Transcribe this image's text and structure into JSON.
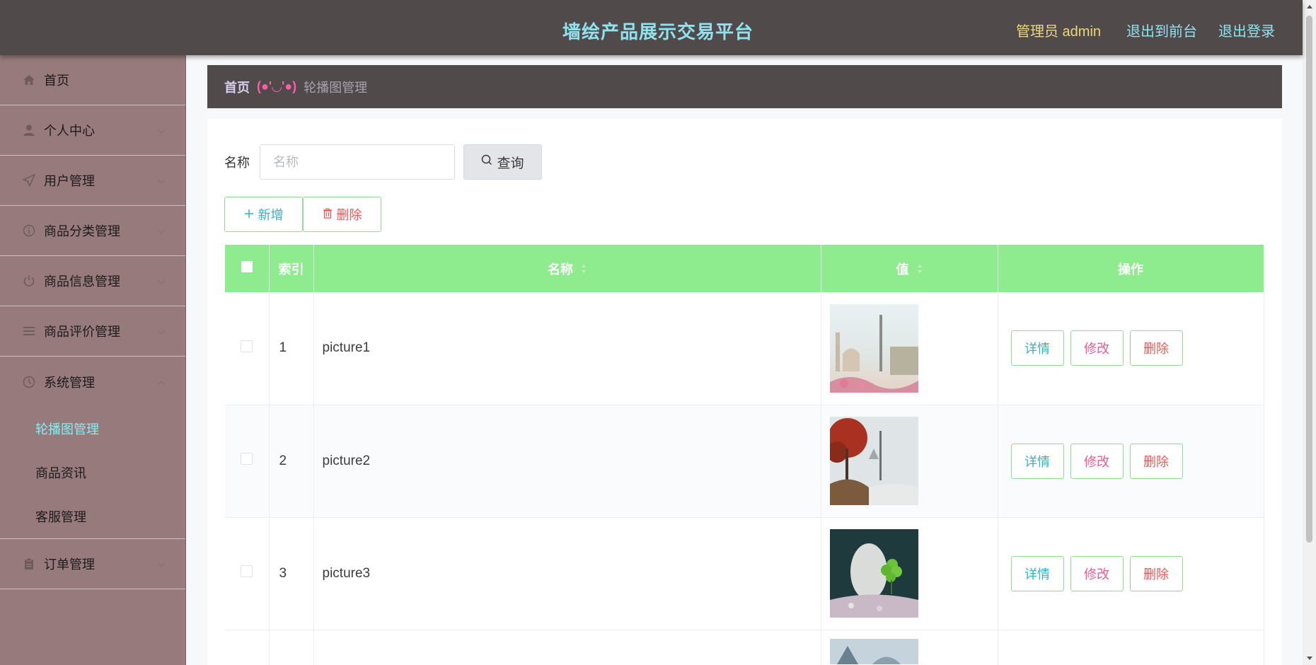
{
  "header": {
    "title": "墙绘产品展示交易平台",
    "admin_label": "管理员 admin",
    "front_link": "退出到前台",
    "logout_link": "退出登录"
  },
  "sidebar": {
    "items": [
      {
        "label": "首页",
        "icon": "home-icon"
      },
      {
        "label": "个人中心",
        "icon": "user-icon"
      },
      {
        "label": "用户管理",
        "icon": "send-icon"
      },
      {
        "label": "商品分类管理",
        "icon": "info-circle-icon"
      },
      {
        "label": "商品信息管理",
        "icon": "power-icon"
      },
      {
        "label": "商品评价管理",
        "icon": "list-icon"
      },
      {
        "label": "系统管理",
        "icon": "clock-icon"
      },
      {
        "label": "订单管理",
        "icon": "clipboard-icon"
      }
    ],
    "system_submenu": [
      "轮播图管理",
      "商品资讯",
      "客服管理"
    ],
    "active_submenu": "轮播图管理"
  },
  "breadcrumb": {
    "home": "首页",
    "separator": "(●'◡'●)",
    "current": "轮播图管理"
  },
  "search": {
    "label": "名称",
    "placeholder": "名称",
    "value": "",
    "button": "查询"
  },
  "actions": {
    "add": "新增",
    "delete": "删除"
  },
  "table": {
    "columns": [
      "索引",
      "名称",
      "值",
      "操作"
    ],
    "rows": [
      {
        "index": "1",
        "name": "picture1"
      },
      {
        "index": "2",
        "name": "picture2"
      },
      {
        "index": "3",
        "name": "picture3"
      }
    ],
    "row_actions": {
      "detail": "详情",
      "edit": "修改",
      "delete": "删除"
    }
  },
  "colors": {
    "header_bg": "#514a4b",
    "title": "#8fe3ee",
    "admin": "#ebd77e",
    "sidebar_bg": "#977a7c",
    "table_header": "#8fec8e",
    "active_menu": "#7ff0f6"
  }
}
